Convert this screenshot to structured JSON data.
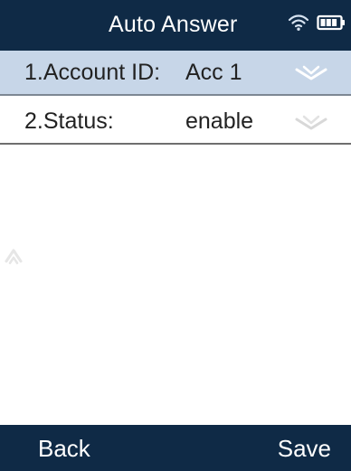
{
  "header": {
    "title": "Auto Answer",
    "icons": [
      "wifi-icon",
      "battery-icon"
    ]
  },
  "list": {
    "items": [
      {
        "label": "1.Account ID:",
        "value": "Acc 1",
        "selected": true,
        "control_icon": "chevron-toggle-icon"
      },
      {
        "label": "2.Status:",
        "value": "enable",
        "selected": false,
        "control_icon": "chevron-toggle-icon"
      }
    ]
  },
  "softkeys": {
    "left": "Back",
    "right": "Save"
  },
  "colors": {
    "bar": "#0f2a46",
    "selected_row": "#c7d6e8",
    "text": "#1b1b1b",
    "divider": "#6e6e6e"
  }
}
